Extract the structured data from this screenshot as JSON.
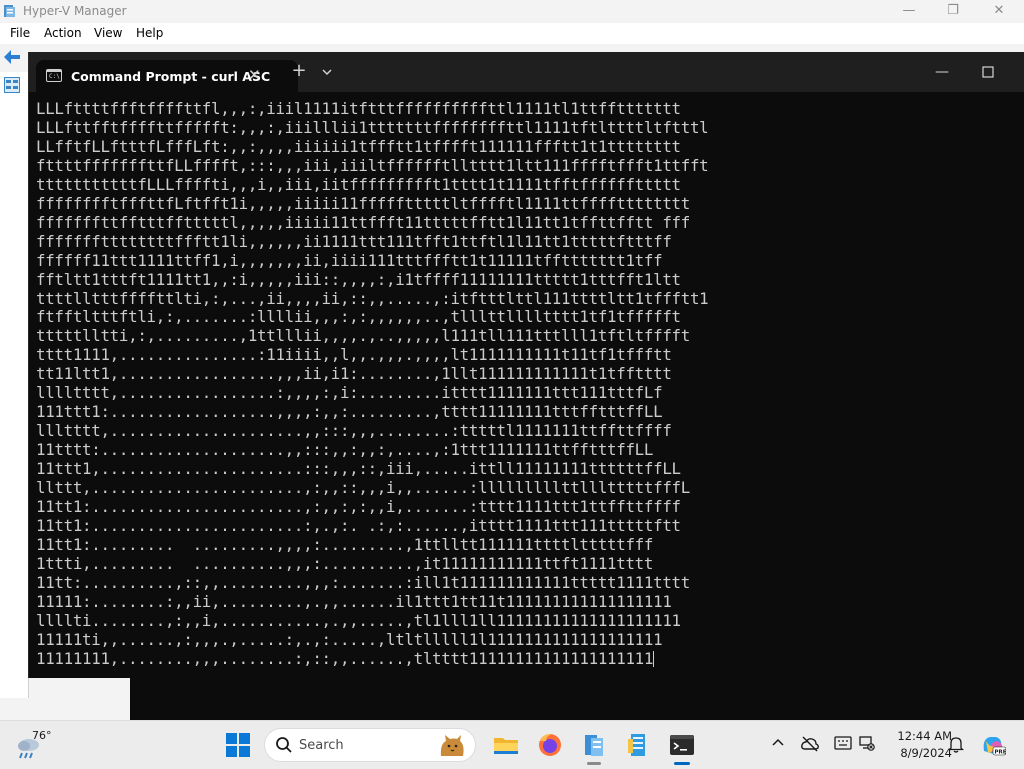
{
  "hyperv": {
    "title": "Hyper-V Manager",
    "menu": [
      "File",
      "Action",
      "View",
      "Help"
    ]
  },
  "terminal": {
    "tab_title": "Command Prompt - curl  ASC",
    "new_tab": "+",
    "lines": [
      "LLLfttttffftffffttfl,,,:,iiil1111itftttffffffffffttl1111tl1ttffttttttt",
      "LLLfttfftffffttffffft:,,,:,iiilllii1tttttttffffffffttl1111tftlttttltftttl",
      "LLfftfLLftttfLfffLft:,,:,,,,iiiiii1tffftt1tfffft111111ffftt1t1tttttttt",
      "fttttfffffffttfLLfffft,:::,,,iii,iiiltfffffftlltttt1ltt111fffftffft1ttfft",
      "tttttttttttfLLLffffti,,,i,,iii,iitffffffffft1tttt1t1111tfftffffffttttt",
      "fffffffftfffttfLftfft1i,,,,,iiiii11ffffftttttltfffftl1111ttfffftttttttt",
      "fffffffttfftttfftttttl,,,,,iiiii11ttffft11tttttfftt1l11tt1tffttfftt fff",
      "fffffffttttttttffftt1li,,,,,,ii1111ttt111tfft1ttftl1l11tt1tttttftttff",
      "ffffff11ttt1111ttff1,i,,,,,,,ii,iiii111tttffftt1t11111tffttttttt1tff",
      "fftltt1tttft1111tt1,,:i,,,,,iii::,,,,:,i1tffff11111111ttttt1tttfft1ltt",
      "ttttlltttffffttlti,:,...,ii,,,,ii,::,,.....,:itftttlttl111ttttltt1tffftt1",
      "ftfftltttftli,:,.......:llllii,,,:,:,,,,,,..,tlllttlllltttt1tf1tffffft",
      "tttttlltti,:,.........,1ttlllii,,,,.,..,,,,,l111tll111tttlll1tftltfffft",
      "tttt1111,...............:11iiii,,l,,.,,,.,,,,lt1111111111t11tf1tffftt",
      "tt11ltt1,.................,,,ii,i1:........,1llt111111111111t1tfftttt",
      "lllltttt,.................:,,,,:,i:.........itttt1111111ttt111tttfLf",
      "111ttt1:..................,,,,:,,:.........,tttt11111111tttfftttffLL",
      "llltttt,.....................,,:::,,,........:tttttl1111111ttffttffff",
      "11tttt:....................,,:::,,:,,:,....,:1ttt1111111ttfftttffLL",
      "11ttt1,......................:::,,,::,iii,.....ittll11111111ttttttffLL",
      "llttt,.......................,:,,::,,,i,,......:lllllllllttllltttttfffL",
      "11tt1:.......................,:,,:,:,,i,.......:tttt1111ttt1ttffttffff",
      "11tt1:.......................:,.,:. .:,:......,itttt1111ttt111tttttftt",
      "11tt1:.........  .........,,,,:.........,1ttlltt111111ttttltttttfff",
      "1ttti,.........  ..........,,,:..........,it11111111111ttft1111tttt",
      "11tt:..........,::,,.........,,,:.......:ill1t111111111111ttttt1111tttt",
      "11111:........:,,ii,.........,.,,......il1ttt1tt11t111111111111111111",
      "llllti........,:,,i,...........,.,,.....,tl1lll1ll11111111111111111111",
      "11111ti,,......,:,,,.,.....:,.,:.....,ltltlllll1l1111111111111111111",
      "11111111,........,,,........:,::,,......,tltttt11111111111111111111"
    ]
  },
  "taskbar": {
    "weather_temp": "76°",
    "search_placeholder": "Search",
    "clock_time": "12:44 AM",
    "clock_date": "8/9/2024"
  },
  "icons": {
    "hyperv_app": "hyperv-icon",
    "terminal_tab": "cmd-icon",
    "start": "windows-logo-icon",
    "apps": [
      "file-explorer-icon",
      "firefox-icon",
      "hyperv-icon",
      "server-manager-icon",
      "terminal-icon"
    ],
    "tray": [
      "chevron-up-icon",
      "cloud-off-icon",
      "keyboard-icon",
      "network-off-icon",
      "notification-bell-icon",
      "copilot-icon"
    ]
  },
  "colors": {
    "terminal_bg": "#0c0c0c",
    "terminal_text": "#cccccc",
    "accent": "#0067c0"
  }
}
